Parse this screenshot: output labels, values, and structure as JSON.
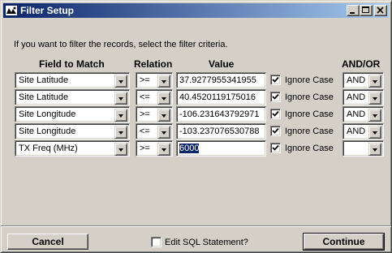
{
  "window": {
    "title": "Filter Setup"
  },
  "instruction": "If you want to filter the records, select the filter criteria.",
  "headers": {
    "field": "Field to Match",
    "relation": "Relation",
    "value": "Value",
    "andor": "AND/OR"
  },
  "rows": [
    {
      "field": "Site Latitude",
      "relation": ">=",
      "value": "37.9277955341955",
      "ignore_case": true,
      "ignore_case_label": "Ignore Case",
      "andor": "AND"
    },
    {
      "field": "Site Latitude",
      "relation": "<=",
      "value": "40.4520119175016",
      "ignore_case": true,
      "ignore_case_label": "Ignore Case",
      "andor": "AND"
    },
    {
      "field": "Site Longitude",
      "relation": ">=",
      "value": "-106.231643792971",
      "ignore_case": true,
      "ignore_case_label": "Ignore Case",
      "andor": "AND"
    },
    {
      "field": "Site Longitude",
      "relation": "<=",
      "value": "-103.237076530788",
      "ignore_case": true,
      "ignore_case_label": "Ignore Case",
      "andor": "AND"
    },
    {
      "field": "TX Freq (MHz)",
      "relation": ">=",
      "value": "6000",
      "ignore_case": true,
      "ignore_case_label": "Ignore Case",
      "andor": ""
    }
  ],
  "footer": {
    "cancel_label": "Cancel",
    "edit_sql_label": "Edit SQL Statement?",
    "edit_sql_checked": false,
    "continue_label": "Continue"
  },
  "icons": {
    "app": "app-icon",
    "minimize": "minimize-icon",
    "maximize": "maximize-icon",
    "close": "close-icon",
    "dropdown": "chevron-down-icon",
    "check": "checkmark-icon"
  },
  "colors": {
    "titlebar_start": "#0a246a",
    "titlebar_end": "#a6caf0",
    "face": "#d4d0c8",
    "selection": "#0a246a"
  }
}
